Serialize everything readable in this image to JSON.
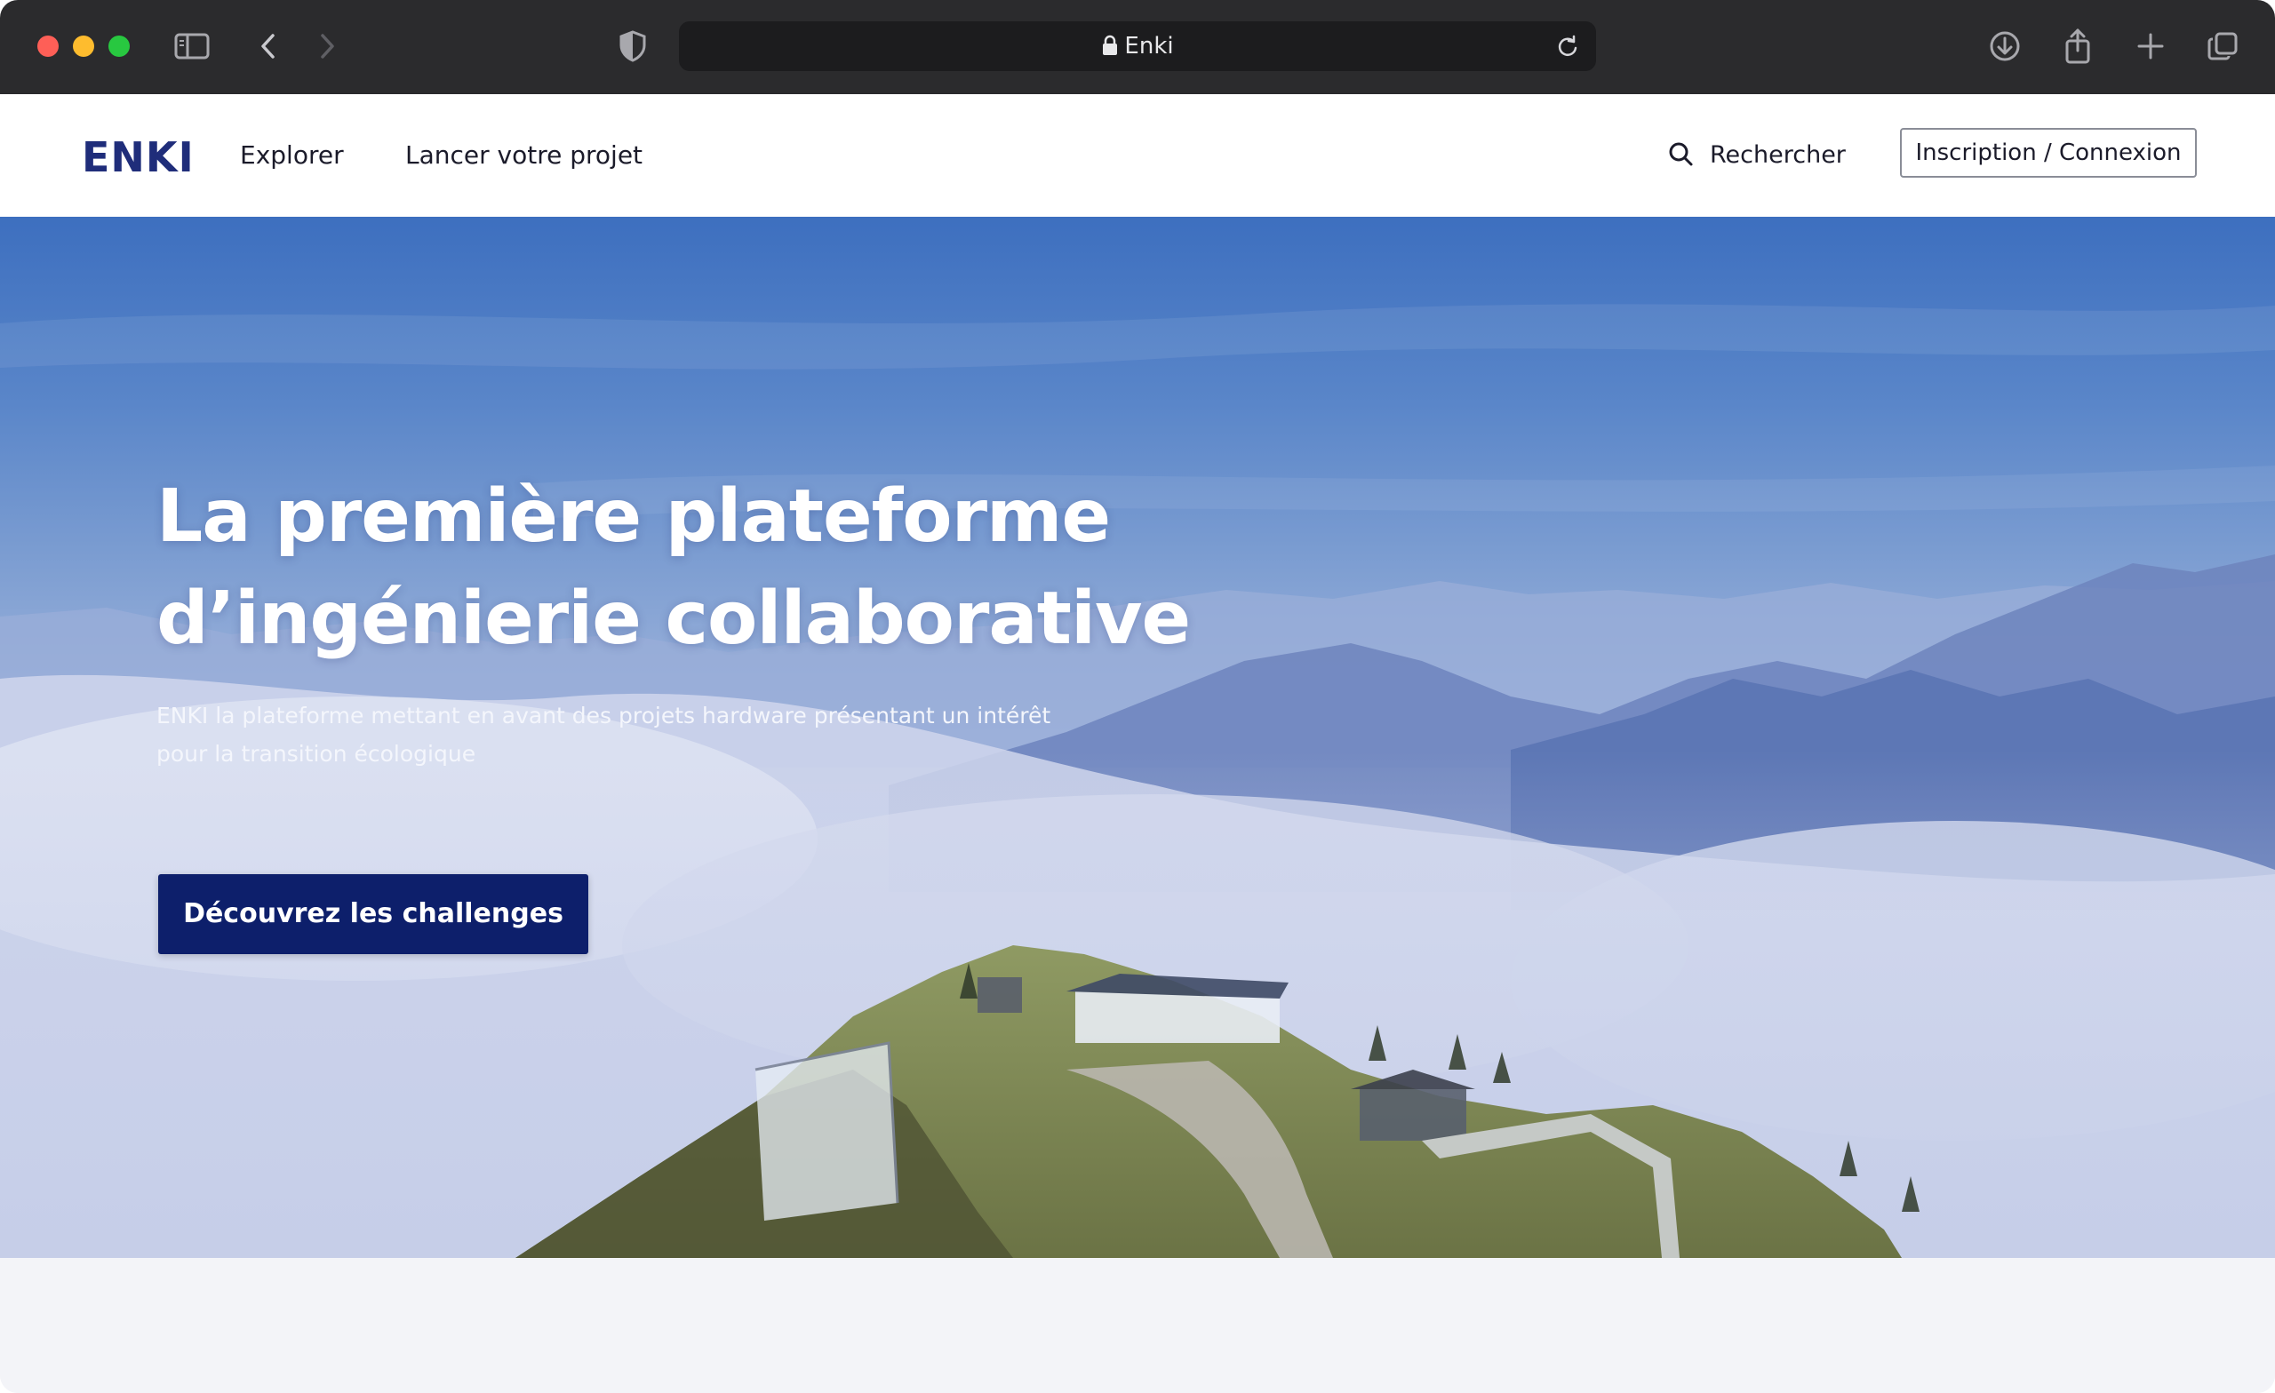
{
  "browser": {
    "url_title": "Enki",
    "colors": {
      "chrome": "#2b2b2d",
      "urlbar": "#1c1c1e"
    },
    "icons": [
      "sidebar-icon",
      "back-icon",
      "forward-icon",
      "shield-icon",
      "lock-icon",
      "reload-icon",
      "download-icon",
      "share-icon",
      "new-tab-icon",
      "tabs-overview-icon"
    ]
  },
  "header": {
    "logo": "ENKI",
    "nav": {
      "explorer": "Explorer",
      "launch": "Lancer votre projet"
    },
    "search_label": "Rechercher",
    "login_label": "Inscription / Connexion"
  },
  "hero": {
    "title_line1": "La première plateforme",
    "title_line2": "d’ingénierie collaborative",
    "subtitle_line1": "ENKI la plateforme mettant en avant des projets hardware présentant  un intérêt",
    "subtitle_line2": "pour la transition écologique",
    "cta_label": "Découvrez les challenges",
    "colors": {
      "cta": "#0d1f6b",
      "logo": "#1f2d7a"
    }
  }
}
